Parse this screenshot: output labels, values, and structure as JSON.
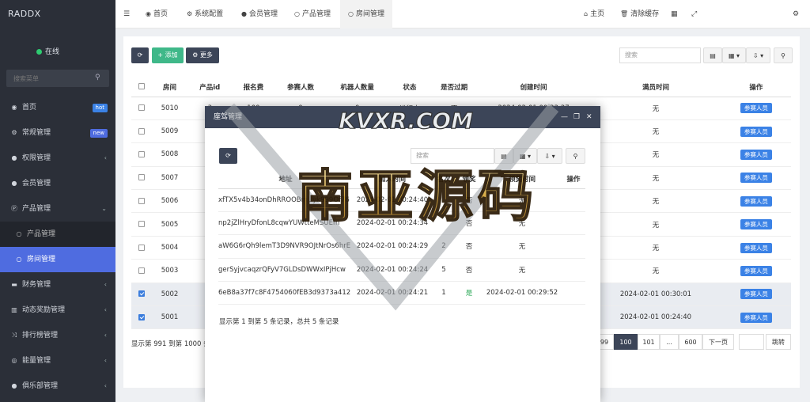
{
  "brand": "RADDX",
  "status": "在线",
  "menu_search_placeholder": "搜索菜单",
  "menu": [
    {
      "label": "首页",
      "icon": "dashboard-icon",
      "badge": "hot",
      "badge_color": "#3b82e6"
    },
    {
      "label": "常规管理",
      "icon": "cogs-icon",
      "badge": "new",
      "badge_color": "#4f6ce0"
    },
    {
      "label": "权限管理",
      "icon": "group-icon",
      "chevron": "‹"
    },
    {
      "label": "会员管理",
      "icon": "user-icon"
    },
    {
      "label": "产品管理",
      "icon": "product-icon",
      "chevron": "⌄"
    },
    {
      "label": "产品管理",
      "icon": "circle-icon",
      "sub": true
    },
    {
      "label": "房间管理",
      "icon": "circle-icon",
      "sub": true,
      "active": true
    },
    {
      "label": "财务管理",
      "icon": "card-icon",
      "chevron": "‹"
    },
    {
      "label": "动态奖励管理",
      "icon": "trash-icon",
      "chevron": "‹"
    },
    {
      "label": "排行榜管理",
      "icon": "random-icon",
      "chevron": "‹"
    },
    {
      "label": "能量管理",
      "icon": "energy-icon",
      "chevron": "‹"
    },
    {
      "label": "俱乐部管理",
      "icon": "group-icon",
      "chevron": "‹"
    }
  ],
  "topnav": {
    "tabs": [
      "首页",
      "系统配置",
      "会员管理",
      "产品管理",
      "房间管理"
    ],
    "right": [
      "主页",
      "清除缓存"
    ]
  },
  "toolbar": {
    "add": "添加",
    "more": "更多",
    "search_placeholder": "搜索"
  },
  "table": {
    "headers": [
      "房间",
      "产品id",
      "报名费",
      "参赛人数",
      "机器人数量",
      "状态",
      "是否过期",
      "创建时间",
      "满员时间",
      "操作"
    ],
    "rows": [
      {
        "room": "5010",
        "pid": "3",
        "fee": "100",
        "players": "0",
        "bots": "0",
        "state": "进行中",
        "expired": "否",
        "created": "2024-02-01 00:22:27",
        "full": "无",
        "checked": false
      },
      {
        "room": "5009",
        "full": "无",
        "checked": false
      },
      {
        "room": "5008",
        "full": "无",
        "checked": false
      },
      {
        "room": "5007",
        "full": "无",
        "checked": false
      },
      {
        "room": "5006",
        "full": "无",
        "checked": false
      },
      {
        "room": "5005",
        "full": "无",
        "checked": false
      },
      {
        "room": "5004",
        "full": "无",
        "checked": false
      },
      {
        "room": "5003",
        "full": "无",
        "checked": false
      },
      {
        "room": "5002",
        "full": "2024-02-01 00:30:01",
        "checked": true
      },
      {
        "room": "5001",
        "full": "2024-02-01 00:24:40",
        "checked": true
      }
    ],
    "op_label": "参赛人员"
  },
  "pagination": {
    "info": "显示第 991 到第 1000 条",
    "pages": [
      "99",
      "100",
      "101",
      "...",
      "600",
      "下一页"
    ],
    "current": "100",
    "jump": "跳转"
  },
  "modal": {
    "title": "座驾管理",
    "search_placeholder": "搜索",
    "headers": [
      "地址",
      "加入时间",
      "名次",
      "领奖",
      "领奖时间",
      "操作"
    ],
    "rows": [
      {
        "addr": "xfTX5v4b34onDhRROOBmUyk999Of76",
        "time": "2024-02-01 00:24:40",
        "rank": "",
        "claimed": "否",
        "claim_time": "无"
      },
      {
        "addr": "np2jZlHryDfonL8cqwYUWtteMSUEm",
        "time": "2024-02-01 00:24:34",
        "rank": "",
        "claimed": "否",
        "claim_time": "无"
      },
      {
        "addr": "aW6G6rQh9lemT3D9NVR9OJtNrOs6hrE",
        "time": "2024-02-01 00:24:29",
        "rank": "2",
        "claimed": "否",
        "claim_time": "无"
      },
      {
        "addr": "gerSyjvcaqzrQFyV7GLDsDWWxIPjHcw",
        "time": "2024-02-01 00:24:24",
        "rank": "5",
        "claimed": "否",
        "claim_time": "无"
      },
      {
        "addr": "6eB8a37f7c8F4754060fEB3d9373a412",
        "time": "2024-02-01 00:24:21",
        "rank": "1",
        "claimed": "是",
        "claim_time": "2024-02-01 00:29:52"
      }
    ],
    "footer": "显示第 1 到第 5 条记录，总共 5 条记录"
  },
  "watermark": {
    "top": "KVXR.COM",
    "main": "南亚源码"
  }
}
